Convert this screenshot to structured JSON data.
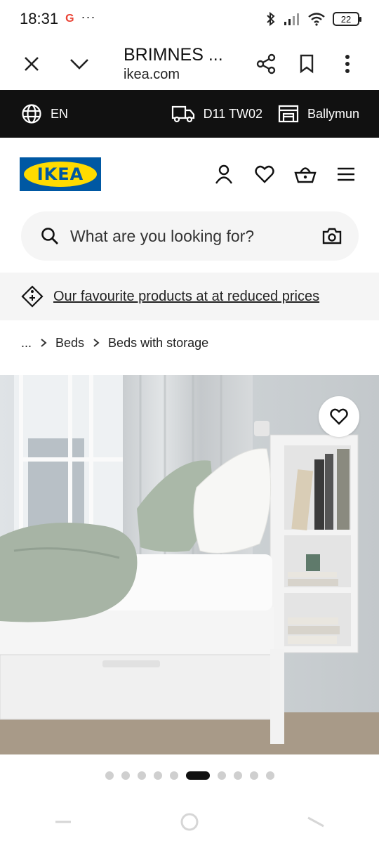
{
  "status_bar": {
    "time": "18:31",
    "google_badge": "G",
    "more": "···",
    "battery": "22"
  },
  "browser": {
    "title": "BRIMNES ...",
    "domain": "ikea.com"
  },
  "top_strip": {
    "language": "EN",
    "postcode": "D11 TW02",
    "store": "Ballymun"
  },
  "header": {
    "logo_text": "IKEA",
    "colors": {
      "brand_blue": "#0058A3",
      "brand_yellow": "#FFDB00"
    }
  },
  "search": {
    "placeholder": "What are you looking for?"
  },
  "promo": {
    "link_text": "Our favourite products at at reduced prices"
  },
  "breadcrumb": {
    "ellipsis": "...",
    "items": [
      "Beds",
      "Beds with storage"
    ]
  },
  "carousel": {
    "total": 10,
    "active_index": 5
  }
}
